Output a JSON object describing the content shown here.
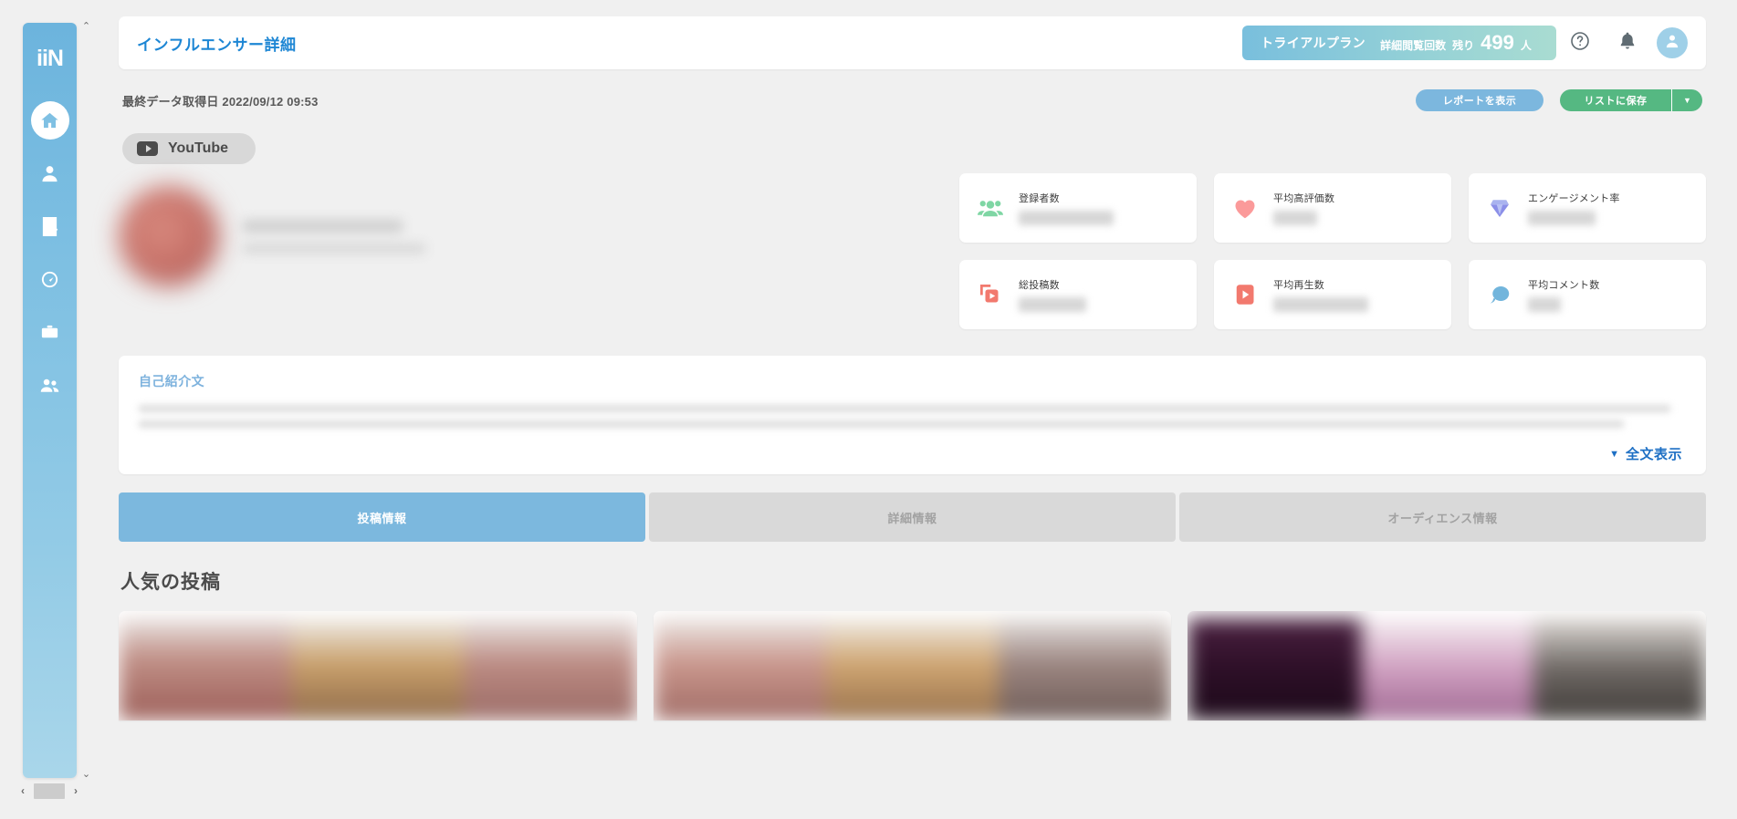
{
  "sidebar": {
    "logo_text": "iiN",
    "items": [
      {
        "key": "home",
        "icon": "home-icon",
        "active": true
      },
      {
        "key": "profile",
        "icon": "person-icon",
        "active": false
      },
      {
        "key": "tasks",
        "icon": "clipboard-check-icon",
        "active": false
      },
      {
        "key": "analytics",
        "icon": "gauge-icon",
        "active": false
      },
      {
        "key": "projects",
        "icon": "briefcase-icon",
        "active": false
      },
      {
        "key": "teams",
        "icon": "group-icon",
        "active": false
      }
    ],
    "scroll": {
      "up_arrow": "⌃",
      "down_arrow": "⌄",
      "left_arrow": "‹",
      "right_arrow": "›"
    }
  },
  "header": {
    "title": "インフルエンサー詳細",
    "plan": {
      "name": "トライアルプラン",
      "meta_label": "詳細閲覧回数",
      "remaining_label": "残り",
      "remaining_count": "499",
      "unit": "人"
    },
    "help_icon": "question-circle-icon",
    "notification_icon": "bell-icon",
    "account_icon": "user-avatar-icon"
  },
  "toolbar": {
    "last_updated_label": "最終データ取得日",
    "last_updated_value": "2022/09/12 09:53",
    "last_updated_full": "最終データ取得日 2022/09/12 09:53",
    "report_button": "レポートを表示",
    "save_button": "リストに保存",
    "save_caret": "▼"
  },
  "platform": {
    "chip_label": "YouTube",
    "chip_icon": "youtube-icon"
  },
  "profile": {
    "avatar_redacted": true,
    "name_redacted": true
  },
  "stats": {
    "cards": [
      {
        "key": "subscribers",
        "label": "登録者数",
        "icon": "people-group-icon",
        "value_redacted": true,
        "value_width": "w-lg"
      },
      {
        "key": "avg_likes",
        "label": "平均高評価数",
        "icon": "heart-icon",
        "value_redacted": true,
        "value_width": "w-sm"
      },
      {
        "key": "engagement",
        "label": "エンゲージメント率",
        "icon": "diamond-icon",
        "value_redacted": true,
        "value_width": "w-md"
      },
      {
        "key": "total_posts",
        "label": "総投稿数",
        "icon": "stacked-video-icon",
        "value_redacted": true,
        "value_width": "w-md"
      },
      {
        "key": "avg_views",
        "label": "平均再生数",
        "icon": "play-button-icon",
        "value_redacted": true,
        "value_width": "w-lg"
      },
      {
        "key": "avg_comments",
        "label": "平均コメント数",
        "icon": "comment-bubble-icon",
        "value_redacted": true,
        "value_width": "w-xs"
      }
    ]
  },
  "bio": {
    "title": "自己紹介文",
    "body_redacted": true,
    "expand_caret": "▼",
    "expand_label": "全文表示"
  },
  "tabs": [
    {
      "key": "posts",
      "label": "投稿情報",
      "active": true
    },
    {
      "key": "details",
      "label": "詳細情報",
      "active": false
    },
    {
      "key": "audience",
      "label": "オーディエンス情報",
      "active": false
    }
  ],
  "posts_section": {
    "title": "人気の投稿",
    "cards": [
      {
        "key": "post-1",
        "thumbnail_redacted": true
      },
      {
        "key": "post-2",
        "thumbnail_redacted": true
      },
      {
        "key": "post-3",
        "thumbnail_redacted": true
      }
    ]
  },
  "colors": {
    "accent_blue": "#1d86d4",
    "sidebar_blue": "#7dbfe2",
    "tab_active": "#7cb8de",
    "save_green": "#55b882",
    "report_blue": "#7cb7de",
    "page_bg": "#f0f0f0"
  }
}
